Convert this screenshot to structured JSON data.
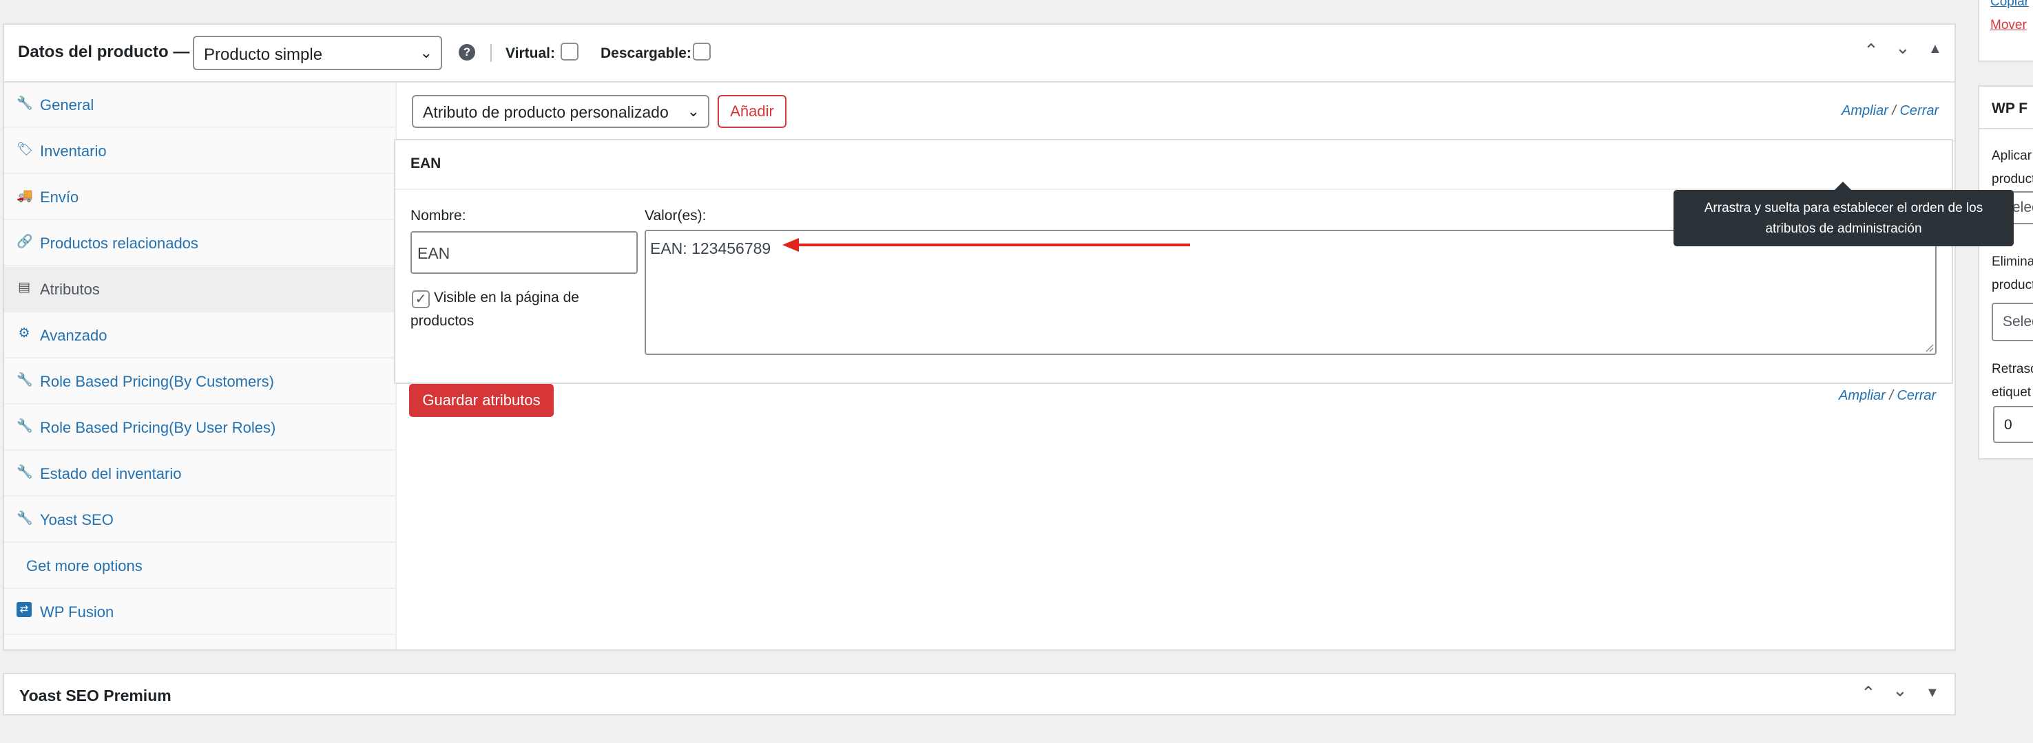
{
  "product_data": {
    "title": "Datos del producto —",
    "type_select": "Producto simple",
    "help_symbol": "?",
    "virtual_label": "Virtual:",
    "downloadable_label": "Descargable:"
  },
  "tabs": [
    {
      "label": "General",
      "icon": "wrench-icon",
      "glyph": "🔧"
    },
    {
      "label": "Inventario",
      "icon": "tag-icon",
      "glyph": "🏷"
    },
    {
      "label": "Envío",
      "icon": "truck-icon",
      "glyph": "🚚"
    },
    {
      "label": "Productos relacionados",
      "icon": "link-icon",
      "glyph": "🔗"
    },
    {
      "label": "Atributos",
      "icon": "table-icon",
      "glyph": "▤"
    },
    {
      "label": "Avanzado",
      "icon": "gear-icon",
      "glyph": "⚙"
    },
    {
      "label": "Role Based Pricing(By Customers)",
      "icon": "wrench-icon",
      "glyph": "🔧"
    },
    {
      "label": "Role Based Pricing(By User Roles)",
      "icon": "wrench-icon",
      "glyph": "🔧"
    },
    {
      "label": "Estado del inventario",
      "icon": "wrench-icon",
      "glyph": "🔧"
    },
    {
      "label": "Yoast SEO",
      "icon": "wrench-icon",
      "glyph": "🔧"
    },
    {
      "label": "Get more options",
      "icon": "",
      "glyph": ""
    },
    {
      "label": "WP Fusion",
      "icon": "wp-fusion-logo-icon",
      "glyph": "⇄"
    }
  ],
  "attributes": {
    "select": "Atributo de producto personalizado",
    "add_button": "Añadir",
    "expand": "Ampliar",
    "separator": "/",
    "close": "Cerrar",
    "ean_title": "EAN",
    "name_label": "Nombre:",
    "name_value": "EAN",
    "values_label": "Valor(es):",
    "values_value": "EAN: 123456789",
    "visible_label": "Visible en la página de productos",
    "save_button": "Guardar atributos",
    "tooltip": "Arrastra y suelta para establecer el orden de los atributos de administración"
  },
  "yoast": {
    "title": "Yoast SEO Premium"
  },
  "sidebar": {
    "link_copy": "Copiar",
    "link_move": "Mover",
    "wpf_title": "WP F",
    "apply_text_1": "Aplicar",
    "apply_text_2": "product",
    "select_placeholder": "Selec",
    "remove_text_1": "Elimina",
    "remove_text_2": "product",
    "delay_text_1": "Retraso",
    "delay_text_2": "etiquet",
    "delay_value": "0"
  },
  "colors": {
    "link": "#2271b1",
    "danger": "#d63638",
    "tooltip_bg": "#2c3338",
    "border": "#dcdcde"
  }
}
